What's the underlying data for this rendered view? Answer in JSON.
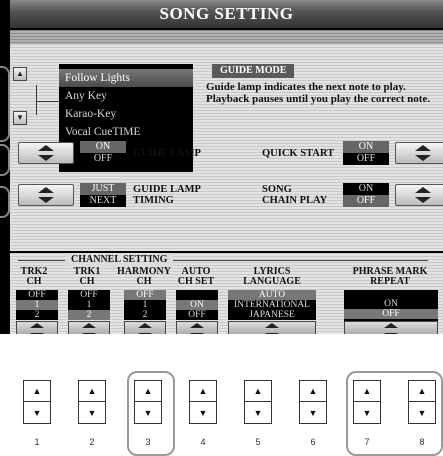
{
  "title": "SONG SETTING",
  "guide_mode": {
    "options": [
      "Follow Lights",
      "Any Key",
      "Karao-Key",
      "Vocal CueTIME"
    ],
    "selected_index": 0,
    "label": "GUIDE MODE",
    "description": "Guide lamp indicates the next note to play. Playback pauses until you play the correct note."
  },
  "guide_lamp": {
    "label": "GUIDE LAMP",
    "on": "ON",
    "off": "OFF",
    "selected": "OFF"
  },
  "quick_start": {
    "label": "QUICK START",
    "on": "ON",
    "off": "OFF",
    "selected": "ON"
  },
  "guide_lamp_timing": {
    "label_line1": "GUIDE LAMP",
    "label_line2": "TIMING",
    "just": "JUST",
    "next": "NEXT",
    "selected": "JUST"
  },
  "song_chain_play": {
    "label_line1": "SONG",
    "label_line2": "CHAIN PLAY",
    "on": "ON",
    "off": "OFF",
    "selected": "OFF"
  },
  "channel_setting": {
    "header": "CHANNEL SETTING",
    "columns": [
      {
        "head1": "TRK2",
        "head2": "CH",
        "values": [
          "OFF",
          "1",
          "2"
        ],
        "selected": 1
      },
      {
        "head1": "TRK1",
        "head2": "CH",
        "values": [
          "OFF",
          "1",
          "2"
        ],
        "selected": 2
      },
      {
        "head1": "HARMONY",
        "head2": "CH",
        "values": [
          "OFF",
          "1",
          "2"
        ],
        "selected": 0
      },
      {
        "head1": "AUTO",
        "head2": "CH SET",
        "values": [
          "",
          "ON",
          "OFF"
        ],
        "selected": 1
      },
      {
        "head1": "LYRICS",
        "head2": "LANGUAGE",
        "values": [
          "AUTO",
          "INTERNATIONAL",
          "JAPANESE"
        ],
        "selected": 0
      },
      {
        "head1": "PHRASE MARK",
        "head2": "REPEAT",
        "values": [
          "ON",
          "OFF"
        ],
        "selected": 1
      }
    ]
  },
  "hardware_buttons": {
    "up": "▲",
    "down": "▼",
    "labels": [
      "1",
      "2",
      "3",
      "4",
      "5",
      "6",
      "7",
      "8"
    ]
  }
}
